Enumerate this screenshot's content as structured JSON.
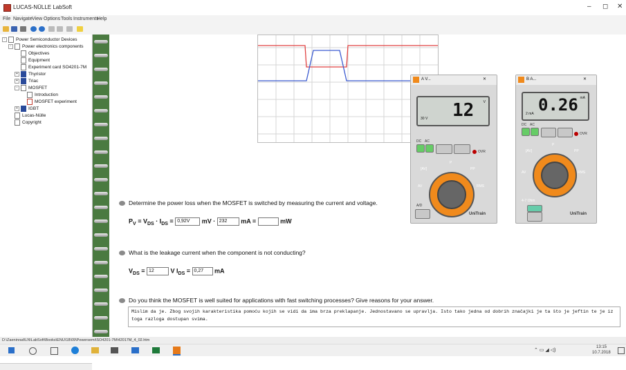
{
  "window": {
    "title": "LUCAS-NÜLLE LabSoft",
    "minimize": "–",
    "restore": "◻",
    "close": "✕"
  },
  "menu": [
    "File",
    "Navigate",
    "View",
    "Options",
    "Tools",
    "Instruments",
    "Help"
  ],
  "tree": [
    "Power Semiconductor Devices",
    "Power electronics components",
    "Objectives",
    "Equipment",
    "Experiment card SO4201-7M",
    "Thyristor",
    "Triac",
    "MOSFET",
    "Introduction",
    "MOSFET experiment",
    "IGBT",
    "Lucas-Nülle",
    "Copyright"
  ],
  "questions": {
    "q1": "Determine the power loss when the MOSFET is switched by measuring the current and voltage.",
    "q2": "What is the leakage current when the component is not conducting?",
    "q3": "Do you think the MOSFET is well suited for applications with fast switching processes? Give reasons for your answer."
  },
  "formula1": {
    "p": "P",
    "p_sub": "V",
    "eq": " = V",
    "vds_sub": "DS",
    "dot": " · I",
    "ids_sub": "DS",
    "eq2": " = ",
    "v_value": "0,92V",
    "v_unit": " mV · ",
    "i_value": "232",
    "i_unit": " mA = ",
    "p_value": "",
    "p_unit": " mW"
  },
  "formula2": {
    "vds": "V",
    "vds_sub": "DS",
    "eq": " = ",
    "v_value": "12",
    "v_unit": " V   I",
    "ids_sub": "DS",
    "eq2": " = ",
    "i_value": "0,27",
    "i_unit": " mA"
  },
  "answer": "Mislim da je. Zbog svojih karakteristika pomoću kojih se vidi da ima brza preklapanje. Jednostavano se upravlja. Isto tako jedna od dobrih značajki je ta što je jeftin te je iz toga razloga dostupan svima.",
  "statusbar": "D:\\Zaeninrad\\LN\\LabSoft\\Books\\ENU\\18\\09\\Powersemi\\SO4201-7M\\42017M_4_02.htm",
  "meter_v": {
    "title": "A V...",
    "display": "12",
    "unit": "V",
    "range": "30 V",
    "dc": "DC",
    "ac": "AC",
    "ovr": "OVR",
    "av": "AV",
    "rms": "RMS",
    "pp": "PP",
    "p": "P",
    "avg": "[AV]",
    "ad": "A/D",
    "brand": "UniTrain"
  },
  "meter_a": {
    "title": "B A...",
    "display": "0.26",
    "unit": "mA",
    "range": "2 mA",
    "dc": "DC",
    "ac": "AC",
    "ovr": "OVR",
    "av": "AV",
    "rms": "RMS",
    "pp": "PP",
    "p": "P",
    "avg": "[AV]",
    "ohm": "4-7 Ohm",
    "brand": "UniTrain"
  },
  "taskbar": {
    "time": "13:15",
    "date": "10.7.2018"
  }
}
